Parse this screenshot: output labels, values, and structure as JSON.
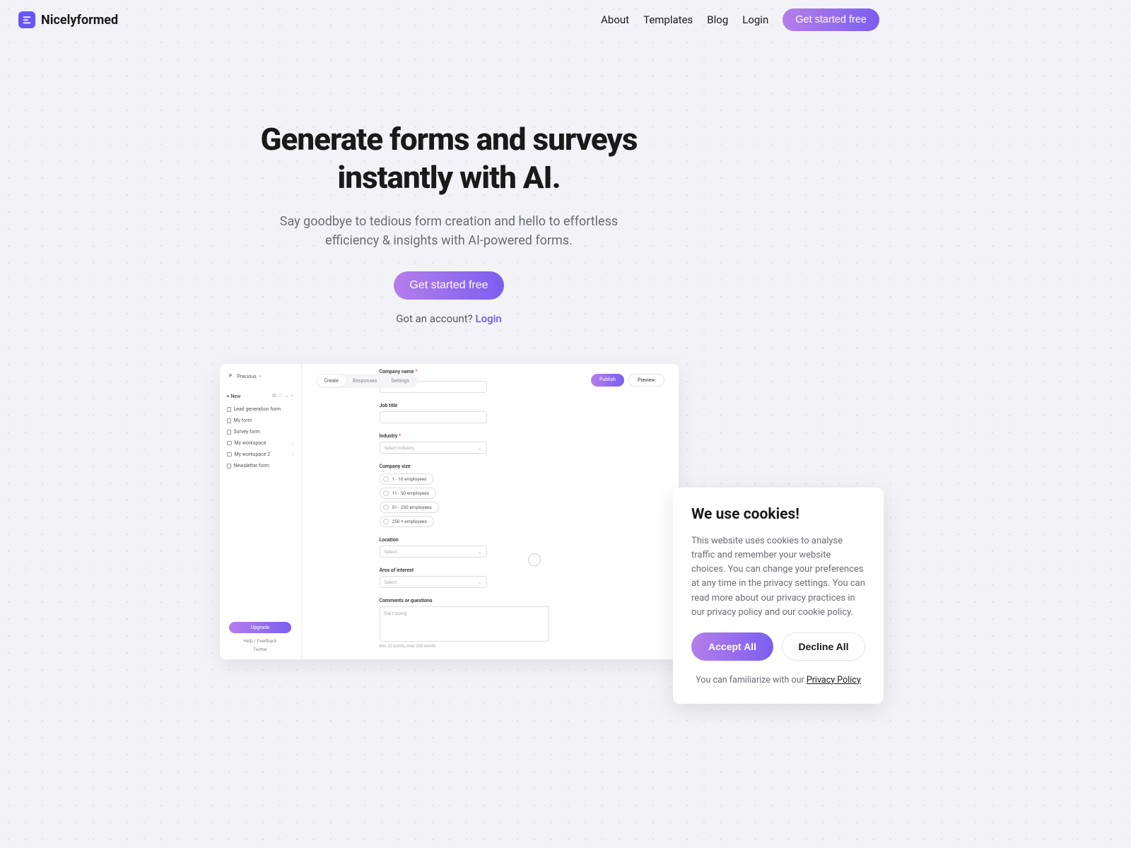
{
  "brand": {
    "name": "Nicelyformed"
  },
  "nav": {
    "about": "About",
    "templates": "Templates",
    "blog": "Blog",
    "login": "Login",
    "cta": "Get started free"
  },
  "hero": {
    "title": "Generate forms and surveys instantly with AI.",
    "subtitle": "Say goodbye to tedious form creation and hello to effortless efficiency & insights with AI-powered forms.",
    "cta": "Get started free",
    "login_prompt": "Got an account? ",
    "login_link": "Login"
  },
  "mockup": {
    "sidebar": {
      "user_initial": "P",
      "user_name": "Precious",
      "new_label": "New",
      "items": [
        {
          "type": "file",
          "label": "Lead generation form"
        },
        {
          "type": "file",
          "label": "My form"
        },
        {
          "type": "file",
          "label": "Survey form"
        },
        {
          "type": "folder",
          "label": "My workspace"
        },
        {
          "type": "folder",
          "label": "My workspace 2"
        },
        {
          "type": "file",
          "label": "Newsletter form"
        }
      ],
      "upgrade": "Upgrade",
      "help": "Help / Feedback",
      "twitter": "Twitter"
    },
    "tabs": {
      "create": "Create",
      "responses": "Responses",
      "settings": "Settings"
    },
    "actions": {
      "publish": "Publish",
      "preview": "Preview"
    },
    "form": {
      "company_name": "Company name",
      "job_title": "Job title",
      "industry": "Industry",
      "industry_placeholder": "Select industry",
      "company_size": "Company size",
      "size_options": [
        "1 - 10 employees",
        "11 - 50 employees",
        "51 - 250 employees",
        "250 + employees"
      ],
      "location": "Location",
      "select_placeholder": "Select",
      "area_of_interest": "Area of interest",
      "comments": "Comments or questions",
      "comments_placeholder": "Start typing",
      "char_hint": "Min 20 words, max 200 words"
    }
  },
  "cookie": {
    "title": "We use cookies!",
    "text": "This website uses cookies to analyse traffic and remember your website choices. You can change your preferences at any time in the privacy settings. You can read more about our privacy practices in our privacy policy and our cookie policy.",
    "accept": "Accept All",
    "decline": "Decline All",
    "footer_text": "You can familiarize with our ",
    "footer_link": "Privacy Policy"
  }
}
